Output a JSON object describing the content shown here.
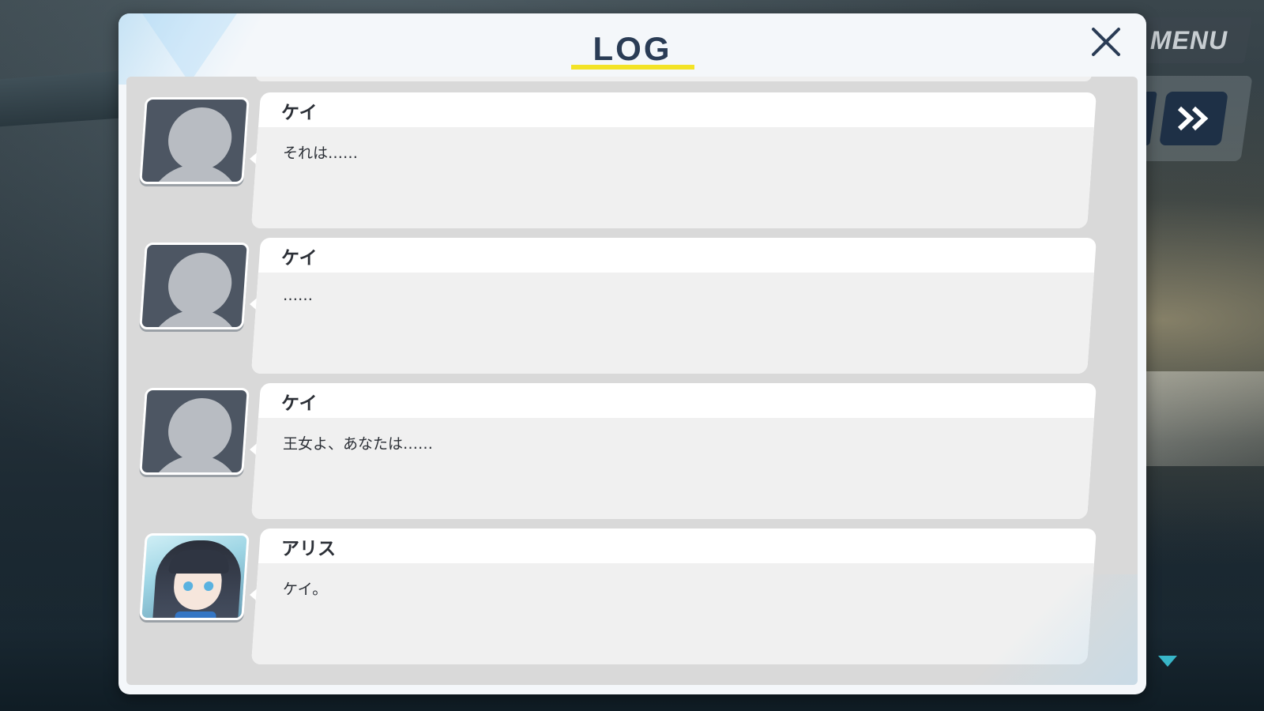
{
  "hud": {
    "menu_label": "MENU"
  },
  "log": {
    "title": "LOG",
    "entries": [
      {
        "speaker": "ケイ",
        "text": "それは……",
        "avatar": "silhouette-placeholder"
      },
      {
        "speaker": "ケイ",
        "text": "……",
        "avatar": "silhouette-placeholder"
      },
      {
        "speaker": "ケイ",
        "text": "王女よ、あなたは……",
        "avatar": "silhouette-placeholder"
      },
      {
        "speaker": "アリス",
        "text": "ケイ。",
        "avatar": "alice-portrait"
      }
    ]
  },
  "colors": {
    "title_underline": "#f3e326",
    "title_text": "#2a3c55",
    "skip_button": "#1e3046",
    "next_indicator": "#38b6c8"
  },
  "icons": {
    "close": "close-icon",
    "skip": "fast-forward-icon",
    "next": "next-triangle-icon"
  }
}
